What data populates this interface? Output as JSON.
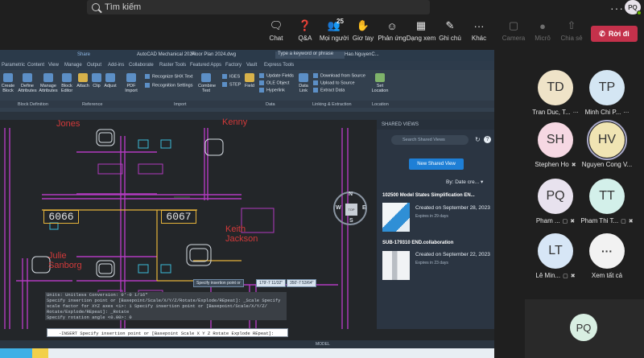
{
  "teams": {
    "search_placeholder": "Tìm kiếm",
    "more": "···",
    "user_initials": "PQ",
    "toolbar": [
      {
        "label": "Chat",
        "icon": "chat-icon"
      },
      {
        "label": "Q&A",
        "icon": "qa-icon"
      },
      {
        "label": "Mọi người",
        "icon": "people-icon"
      },
      {
        "label": "Giơ tay",
        "icon": "raise-hand-icon"
      },
      {
        "label": "Phản ứng",
        "icon": "reaction-icon"
      },
      {
        "label": "Dạng xem",
        "icon": "view-icon"
      },
      {
        "label": "Ghi chú",
        "icon": "notes-icon"
      },
      {
        "label": "Khác",
        "icon": "more-icon"
      },
      {
        "label": "Camera",
        "icon": "camera-icon"
      },
      {
        "label": "Micrô",
        "icon": "mic-icon"
      },
      {
        "label": "Chia sẻ",
        "icon": "share-icon"
      }
    ],
    "people_count": "25",
    "leave_label": "Rời đi",
    "leave_color": "#c4314b"
  },
  "participants": [
    {
      "initials": "TD",
      "name": "Tran Duc, T...",
      "color": "#efe3c8"
    },
    {
      "initials": "TP",
      "name": "Minh Chi P...",
      "color": "#d4e6f3"
    },
    {
      "initials": "SH",
      "name": "Stephen Ho",
      "color": "#f6d8e3"
    },
    {
      "initials": "HV",
      "name": "Nguyen Cong V...",
      "color": "#f0e4b3"
    },
    {
      "initials": "PQ",
      "name": "Pham ...",
      "color": "#e8e2ee"
    },
    {
      "initials": "TT",
      "name": "Pham Thi T...",
      "color": "#d3f0ea"
    },
    {
      "initials": "LT",
      "name": "Lê Min...",
      "color": "#d7e6f6"
    },
    {
      "initials": "···",
      "name": "Xem tất cả",
      "color": "#f2f2f2"
    }
  ],
  "self_initials": "PQ",
  "autocad": {
    "app_title": "AutoCAD Mechanical 2024",
    "file_title": "Floor Plan 2024.dwg",
    "search_hint": "Type a keyword or phrase",
    "user": "Hao.NguyenC...",
    "share": "Share",
    "menu": [
      "Parametric",
      "Content",
      "View",
      "Manage",
      "Output",
      "Add-ins",
      "Collaborate",
      "Raster Tools",
      "Featured Apps",
      "Factory",
      "Vault",
      "Express Tools"
    ],
    "ribbon_buttons": [
      {
        "label": "Create Block",
        "tone": "b"
      },
      {
        "label": "Define Attributes",
        "tone": "b"
      },
      {
        "label": "Manage Attributes",
        "tone": "b"
      },
      {
        "label": "Block Editor",
        "tone": "b"
      },
      {
        "label": "Attach",
        "tone": "y"
      },
      {
        "label": "Clip",
        "tone": "b"
      },
      {
        "label": "Adjust",
        "tone": "b"
      },
      {
        "label": "PDF Import",
        "tone": "b"
      },
      {
        "label": "Combine Text",
        "tone": "b"
      },
      {
        "label": "Field",
        "tone": "y"
      },
      {
        "label": "Data Link",
        "tone": "b"
      },
      {
        "label": "Set Location",
        "tone": "g"
      }
    ],
    "ribbon_small": [
      "Recognize SHX Text",
      "Recognition Settings",
      "IGES",
      "STEP",
      "Update Fields",
      "OLE Object",
      "Hyperlink",
      "Download from Source",
      "Upload to Source",
      "Extract Data"
    ],
    "panels": [
      "Block Definition",
      "Reference",
      "Import",
      "Data",
      "Linking & Extraction",
      "Location"
    ],
    "drawing": {
      "names": [
        "Jones",
        "Kenny",
        "Keith Jackson",
        "Julie Sanborg"
      ],
      "rooms": [
        "6066",
        "6067"
      ],
      "cursor_tip": "Specify insertion point or",
      "coords": [
        "179'-7 11/32\"",
        "350'-7 53/64\""
      ],
      "viewcube": {
        "face": "TOP",
        "n": "N",
        "e": "E",
        "s": "S",
        "w": "W"
      }
    },
    "shared_views": {
      "header": "SHARED VIEWS",
      "search": "Search Shared Views",
      "new_button": "New Shared View",
      "sort": "By: Date cre...",
      "items": [
        {
          "title": "102500 Model States Simplification EN...",
          "created": "Created on September 28, 2023",
          "expires": "Expires in 29 days"
        },
        {
          "title": "SUB-179310 END.collaboration",
          "created": "Created on September 22, 2023",
          "expires": "Expires in 23 days"
        }
      ]
    },
    "command_history": [
      "Units: Unitless   Conversion: 0'-0 1/16\"",
      "Specify insertion point or [Basepoint/Scale/X/Y/Z/Rotate/Explode/REpeat]: _Scale Specify",
      "scale factor for XYZ axes <1>: 1 Specify insertion point or [Basepoint/Scale/X/Y/Z/",
      "Rotate/Explode/REpeat]: _Rotate",
      "Specify rotation angle <0.00>: 0"
    ],
    "command_input": "-INSERT Specify insertion point or [Basepoint Scale X Y Z Rotate Explode REpeat]:",
    "status_model": "MODEL"
  }
}
